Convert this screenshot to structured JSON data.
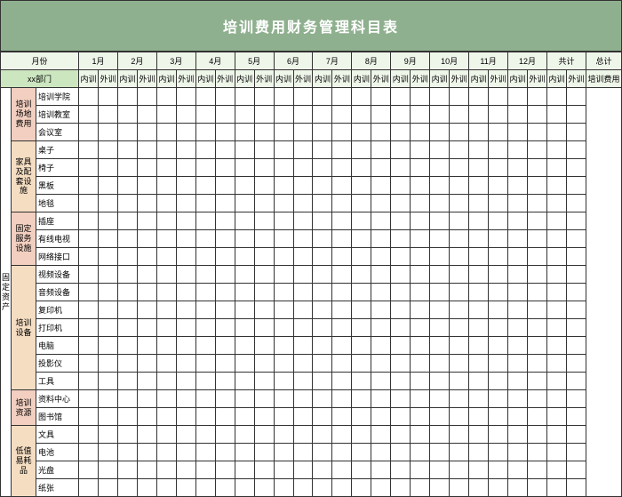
{
  "title": "培训费用财务管理科目表",
  "header": {
    "month_label": "月份",
    "dept_label": "xx部门",
    "months": [
      "1月",
      "2月",
      "3月",
      "4月",
      "5月",
      "6月",
      "7月",
      "8月",
      "9月",
      "10月",
      "11月",
      "12月"
    ],
    "sub_left": "内训",
    "sub_right": "外训",
    "total_col": "共计",
    "grand_col": "总计",
    "grand_sub": "培训费用"
  },
  "side_category": "固定资产",
  "groups": [
    {
      "name": "培训场地费用",
      "color": "rose",
      "items": [
        "培训学院",
        "培训教室",
        "会议室"
      ]
    },
    {
      "name": "家具及配套设施",
      "color": "peach",
      "items": [
        "桌子",
        "椅子",
        "黑板",
        "地毯"
      ]
    },
    {
      "name": "固定服务设施",
      "color": "rose",
      "items": [
        "插座",
        "有线电视",
        "网络接口"
      ]
    },
    {
      "name": "培训设备",
      "color": "peach",
      "items": [
        "视频设备",
        "音频设备",
        "复印机",
        "打印机",
        "电脑",
        "投影仪",
        "工具"
      ]
    },
    {
      "name": "培训资源",
      "color": "rose",
      "items": [
        "资料中心",
        "图书馆"
      ]
    },
    {
      "name": "低值易耗品",
      "color": "peach",
      "items": [
        "文具",
        "电池",
        "光盘",
        "纸张"
      ]
    }
  ],
  "values": {}
}
